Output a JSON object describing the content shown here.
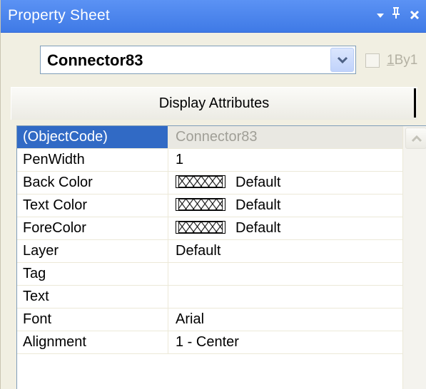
{
  "window": {
    "title": "Property Sheet",
    "title_buttons": {
      "dropdown_glyph": "▾",
      "pin_glyph": "ᴾ",
      "close_glyph": "x"
    }
  },
  "object_selector": {
    "value": "Connector83",
    "checkbox": {
      "mnemonic": "1",
      "label_rest": "By1",
      "checked": false,
      "enabled": false
    }
  },
  "tabs": [
    {
      "label": "Display Attributes",
      "active": true
    }
  ],
  "properties": [
    {
      "name": "(ObjectCode)",
      "value": "Connector83",
      "selected": true
    },
    {
      "name": "PenWidth",
      "value": "1"
    },
    {
      "name": "Back Color",
      "value": "Default",
      "swatch": true
    },
    {
      "name": "Text Color",
      "value": "Default",
      "swatch": true
    },
    {
      "name": "ForeColor",
      "value": "Default",
      "swatch": true
    },
    {
      "name": "Layer",
      "value": "Default"
    },
    {
      "name": "Tag",
      "value": ""
    },
    {
      "name": "Text",
      "value": ""
    },
    {
      "name": "Font",
      "value": "Arial"
    },
    {
      "name": "Alignment",
      "value": "1 - Center"
    }
  ],
  "colors": {
    "titlebar": "#4a83ec",
    "selection": "#316ac5",
    "panel_background": "#f1efe2",
    "grid_lines": "#ece9d8"
  },
  "icons": {
    "swatch_pattern": "crosshatch-swatch-icon",
    "combo_arrow": "chevron-down-icon",
    "scroll_up": "chevron-up-icon"
  }
}
